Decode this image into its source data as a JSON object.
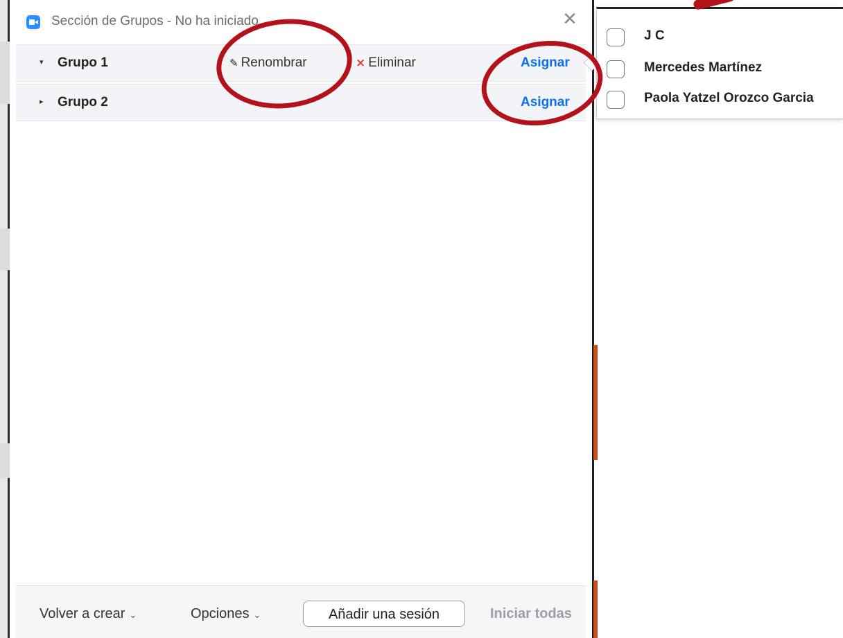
{
  "window": {
    "title": "Sección de Grupos - No ha iniciado",
    "close_symbol": "✕"
  },
  "groups": [
    {
      "caret": "▾",
      "name": "Grupo 1",
      "rename_label": "Renombrar",
      "delete_label": "Eliminar",
      "assign_label": "Asignar",
      "expanded": true
    },
    {
      "caret": "▸",
      "name": "Grupo 2",
      "assign_label": "Asignar",
      "expanded": false
    }
  ],
  "bottom_bar": {
    "recreate_label": "Volver a crear",
    "options_label": "Opciones",
    "add_session_label": "Añadir una sesión",
    "start_all_label": "Iniciar todas",
    "chevron": "⌄"
  },
  "assign_popup": {
    "participants": [
      {
        "name": "J C",
        "checked": false
      },
      {
        "name": "Mercedes Martínez",
        "checked": false
      },
      {
        "name": "Paola Yatzel Orozco Garcia",
        "checked": false
      }
    ]
  },
  "colors": {
    "accent_blue": "#0e71eb",
    "delete_red": "#e53935",
    "annotation_red": "#b3121a",
    "app_icon_blue": "#2d8cff"
  },
  "icons": {
    "pencil": "✎",
    "delete_x": "×"
  }
}
